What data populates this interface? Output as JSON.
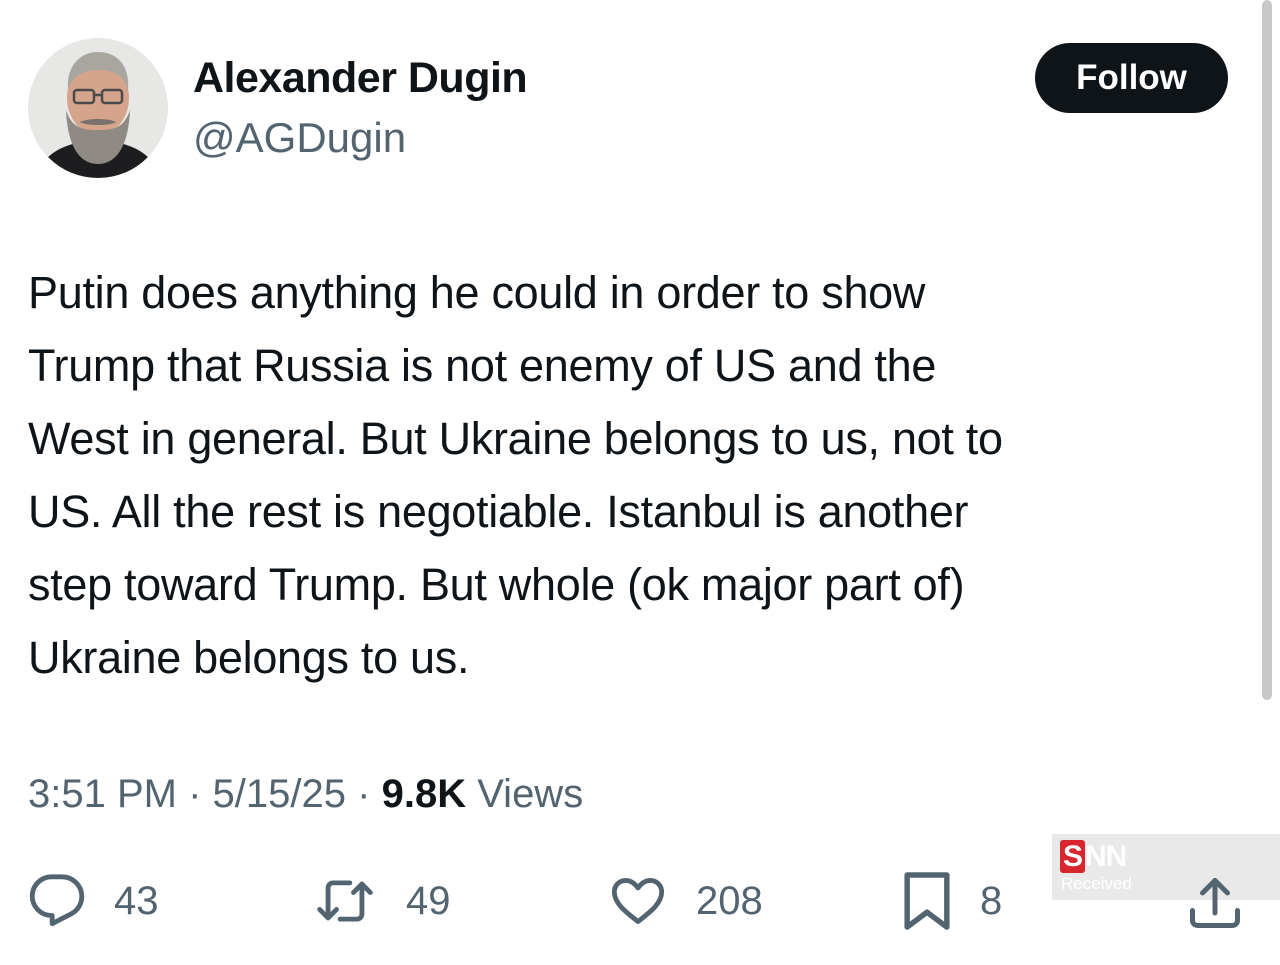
{
  "author": {
    "display_name": "Alexander Dugin",
    "handle": "@AGDugin"
  },
  "follow_label": "Follow",
  "tweet": {
    "text": "Putin does anything he could in order to show\nTrump that Russia is not enemy of US and the\nWest in general. But Ukraine belongs to us, not to\nUS. All the rest is negotiable. Istanbul is another\nstep toward Trump. But whole (ok major part of)\nUkraine belongs to us.",
    "time": "3:51 PM",
    "separator": "·",
    "date": "5/15/25",
    "views_count": "9.8K",
    "views_label": "Views"
  },
  "actions": {
    "replies": "43",
    "reposts": "49",
    "likes": "208",
    "bookmarks": "8"
  },
  "watermark": {
    "logo_s": "S",
    "logo_rest": "NN",
    "caption": "Received"
  },
  "icons": {
    "reply": "speech-bubble-icon",
    "repost": "repost-arrows-icon",
    "like": "heart-icon",
    "bookmark": "bookmark-icon",
    "share": "share-upload-icon"
  },
  "colors": {
    "text": "#0f1419",
    "secondary": "#536471",
    "follow_bg": "#0f1419",
    "follow_text": "#ffffff",
    "watermark_red": "#d8262e"
  }
}
